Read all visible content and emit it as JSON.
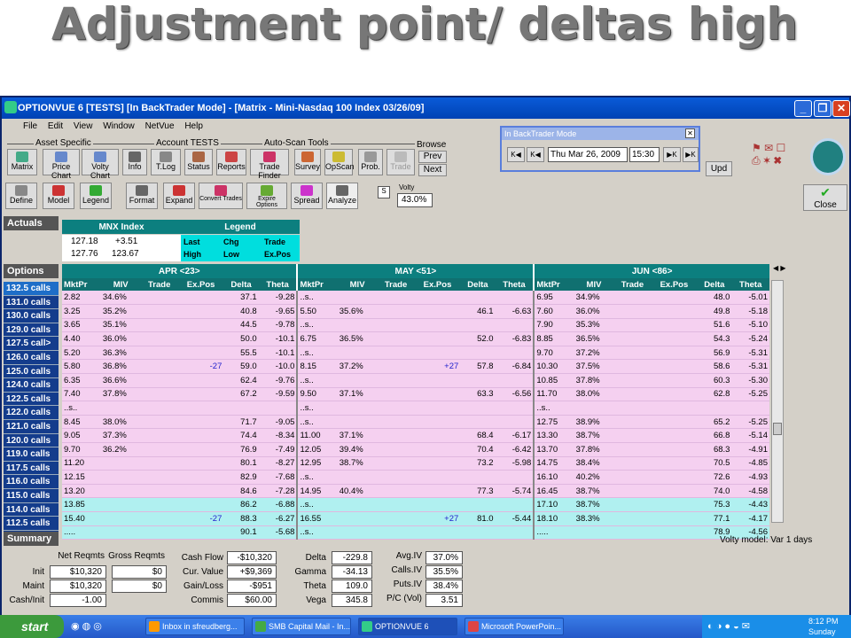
{
  "slide_title": "Adjustment point/ deltas high",
  "window_title": "OPTIONVUE 6   [TESTS]  [In BackTrader Mode] - [Matrix - Mini-Nasdaq 100 Index  03/26/09]",
  "menu": [
    "File",
    "Edit",
    "View",
    "Window",
    "NetVue",
    "Help"
  ],
  "groups": {
    "asset": "Asset Specific",
    "account": "Account TESTS",
    "autoscan": "Auto-Scan Tools",
    "browse": "Browse"
  },
  "toolbar1": [
    "Matrix",
    "Price Chart",
    "Volty Chart",
    "Info",
    "T.Log",
    "Status",
    "Reports",
    "Trade Finder",
    "Survey",
    "OpScan",
    "Prob.",
    "Trade"
  ],
  "browse": {
    "prev": "Prev",
    "next": "Next"
  },
  "toolbar2": [
    "Define",
    "Model",
    "Legend",
    "Format",
    "Expand",
    "Convert Trades",
    "Expire Options",
    "Spread",
    "Analyze"
  ],
  "volty": {
    "label": "Volty",
    "value": "43.0%",
    "s": "S"
  },
  "backtrader": {
    "title": "In BackTrader Mode",
    "date": "Thu Mar 26, 2009",
    "time": "15:30"
  },
  "upd": "Upd",
  "close": "Close",
  "actuals": {
    "label": "Actuals",
    "index": "MNX Index",
    "legend": "Legend",
    "r1": [
      "127.18",
      "+3.51"
    ],
    "r2": [
      "127.76",
      "123.67"
    ],
    "leg1": [
      "Last",
      "Chg",
      "Trade"
    ],
    "leg2": [
      "High",
      "Low",
      "Ex.Pos"
    ]
  },
  "options_label": "Options",
  "months": [
    "APR <23>",
    "MAY <51>",
    "JUN <86>"
  ],
  "cols": [
    "MktPr",
    "MIV",
    "Trade",
    "Ex.Pos",
    "Delta",
    "Theta"
  ],
  "strikes": [
    "132.5 calls",
    "131.0 calls",
    "130.0 calls",
    "129.0 calls",
    "127.5 call>",
    "126.0 calls",
    "125.0 calls",
    "124.0 calls",
    "122.5 calls",
    "122.0 calls",
    "121.0 calls",
    "120.0 calls",
    "119.0 calls",
    "117.5 calls",
    "116.0 calls",
    "115.0 calls",
    "114.0 calls",
    "112.5 calls",
    "111.0 calls"
  ],
  "rows": [
    [
      [
        "2.82",
        "34.6%",
        "",
        "",
        "37.1",
        "-9.28"
      ],
      [
        "..s..",
        "",
        "",
        "",
        "",
        ""
      ],
      [
        "6.95",
        "34.9%",
        "",
        "",
        "48.0",
        "-5.01"
      ]
    ],
    [
      [
        "3.25",
        "35.2%",
        "",
        "",
        "40.8",
        "-9.65"
      ],
      [
        "5.50",
        "35.6%",
        "",
        "",
        "46.1",
        "-6.63"
      ],
      [
        "7.60",
        "36.0%",
        "",
        "",
        "49.8",
        "-5.18"
      ]
    ],
    [
      [
        "3.65",
        "35.1%",
        "",
        "",
        "44.5",
        "-9.78"
      ],
      [
        "..s..",
        "",
        "",
        "",
        "",
        ""
      ],
      [
        "7.90",
        "35.3%",
        "",
        "",
        "51.6",
        "-5.10"
      ]
    ],
    [
      [
        "4.40",
        "36.0%",
        "",
        "",
        "50.0",
        "-10.1"
      ],
      [
        "6.75",
        "36.5%",
        "",
        "",
        "52.0",
        "-6.83"
      ],
      [
        "8.85",
        "36.5%",
        "",
        "",
        "54.3",
        "-5.24"
      ]
    ],
    [
      [
        "5.20",
        "36.3%",
        "",
        "",
        "55.5",
        "-10.1"
      ],
      [
        "..s..",
        "",
        "",
        "",
        "",
        ""
      ],
      [
        "9.70",
        "37.2%",
        "",
        "",
        "56.9",
        "-5.31"
      ]
    ],
    [
      [
        "5.80",
        "36.8%",
        "",
        "-27",
        "59.0",
        "-10.0"
      ],
      [
        "8.15",
        "37.2%",
        "",
        "+27",
        "57.8",
        "-6.84"
      ],
      [
        "10.30",
        "37.5%",
        "",
        "",
        "58.6",
        "-5.31"
      ]
    ],
    [
      [
        "6.35",
        "36.6%",
        "",
        "",
        "62.4",
        "-9.76"
      ],
      [
        "..s..",
        "",
        "",
        "",
        "",
        ""
      ],
      [
        "10.85",
        "37.8%",
        "",
        "",
        "60.3",
        "-5.30"
      ]
    ],
    [
      [
        "7.40",
        "37.8%",
        "",
        "",
        "67.2",
        "-9.59"
      ],
      [
        "9.50",
        "37.1%",
        "",
        "",
        "63.3",
        "-6.56"
      ],
      [
        "11.70",
        "38.0%",
        "",
        "",
        "62.8",
        "-5.25"
      ]
    ],
    [
      [
        "..s..",
        "",
        "",
        "",
        "",
        ""
      ],
      [
        "..s..",
        "",
        "",
        "",
        "",
        ""
      ],
      [
        "..s..",
        "",
        "",
        "",
        "",
        ""
      ]
    ],
    [
      [
        "8.45",
        "38.0%",
        "",
        "",
        "71.7",
        "-9.05"
      ],
      [
        "..s..",
        "",
        "",
        "",
        "",
        ""
      ],
      [
        "12.75",
        "38.9%",
        "",
        "",
        "65.2",
        "-5.25"
      ]
    ],
    [
      [
        "9.05",
        "37.3%",
        "",
        "",
        "74.4",
        "-8.34"
      ],
      [
        "11.00",
        "37.1%",
        "",
        "",
        "68.4",
        "-6.17"
      ],
      [
        "13.30",
        "38.7%",
        "",
        "",
        "66.8",
        "-5.14"
      ]
    ],
    [
      [
        "9.70",
        "36.2%",
        "",
        "",
        "76.9",
        "-7.49"
      ],
      [
        "12.05",
        "39.4%",
        "",
        "",
        "70.4",
        "-6.42"
      ],
      [
        "13.70",
        "37.8%",
        "",
        "",
        "68.3",
        "-4.91"
      ]
    ],
    [
      [
        "11.20",
        "",
        "",
        "",
        "80.1",
        "-8.27"
      ],
      [
        "12.95",
        "38.7%",
        "",
        "",
        "73.2",
        "-5.98"
      ],
      [
        "14.75",
        "38.4%",
        "",
        "",
        "70.5",
        "-4.85"
      ]
    ],
    [
      [
        "12.15",
        "",
        "",
        "",
        "82.9",
        "-7.68"
      ],
      [
        "..s..",
        "",
        "",
        "",
        "",
        ""
      ],
      [
        "16.10",
        "40.2%",
        "",
        "",
        "72.6",
        "-4.93"
      ]
    ],
    [
      [
        "13.20",
        "",
        "",
        "",
        "84.6",
        "-7.28"
      ],
      [
        "14.95",
        "40.4%",
        "",
        "",
        "77.3",
        "-5.74"
      ],
      [
        "16.45",
        "38.7%",
        "",
        "",
        "74.0",
        "-4.58"
      ]
    ],
    [
      [
        "13.85",
        "",
        "",
        "",
        "86.2",
        "-6.88"
      ],
      [
        "..s..",
        "",
        "",
        "",
        "",
        ""
      ],
      [
        "17.10",
        "38.7%",
        "",
        "",
        "75.3",
        "-4.43"
      ]
    ],
    [
      [
        "15.40",
        "",
        "",
        "-27",
        "88.3",
        "-6.27"
      ],
      [
        "16.55",
        "",
        "",
        "+27",
        "81.0",
        "-5.44"
      ],
      [
        "18.10",
        "38.3%",
        "",
        "",
        "77.1",
        "-4.17"
      ]
    ],
    [
      [
        ".....",
        "",
        "",
        "",
        "90.1",
        "-5.68"
      ],
      [
        "..s..",
        "",
        "",
        "",
        "",
        ""
      ],
      [
        ".....",
        "",
        "",
        "",
        "78.9",
        "-4.56"
      ]
    ]
  ],
  "summary": {
    "label": "Summary",
    "net": "Net Reqmts",
    "gross": "Gross Reqmts",
    "init": "Init",
    "maint": "Maint",
    "cashinit": "Cash/Init",
    "net_init": "$10,320",
    "net_maint": "$10,320",
    "net_ci": "-1.00",
    "gross_init": "$0",
    "gross_maint": "$0",
    "cashflow": "Cash Flow",
    "cashflow_v": "-$10,320",
    "curval": "Cur. Value",
    "curval_v": "+$9,369",
    "gainloss": "Gain/Loss",
    "gainloss_v": "-$951",
    "commis": "Commis",
    "commis_v": "$60.00",
    "delta": "Delta",
    "delta_v": "-229.8",
    "gamma": "Gamma",
    "gamma_v": "-34.13",
    "theta": "Theta",
    "theta_v": "109.0",
    "vega": "Vega",
    "vega_v": "345.8",
    "avgiv": "Avg.IV",
    "avgiv_v": "37.0%",
    "callsiv": "Calls.IV",
    "callsiv_v": "35.5%",
    "putsiv": "Puts.IV",
    "putsiv_v": "38.4%",
    "pc": "P/C (Vol)",
    "pc_v": "3.51",
    "volty_model": "Volty model: Var 1 days"
  },
  "taskbar": {
    "start": "start",
    "items": [
      "Inbox in sfreudberg...",
      "SMB Capital Mail - In...",
      "OPTIONVUE 6",
      "Microsoft PowerPoin..."
    ],
    "time": "8:12 PM",
    "day": "Sunday"
  }
}
